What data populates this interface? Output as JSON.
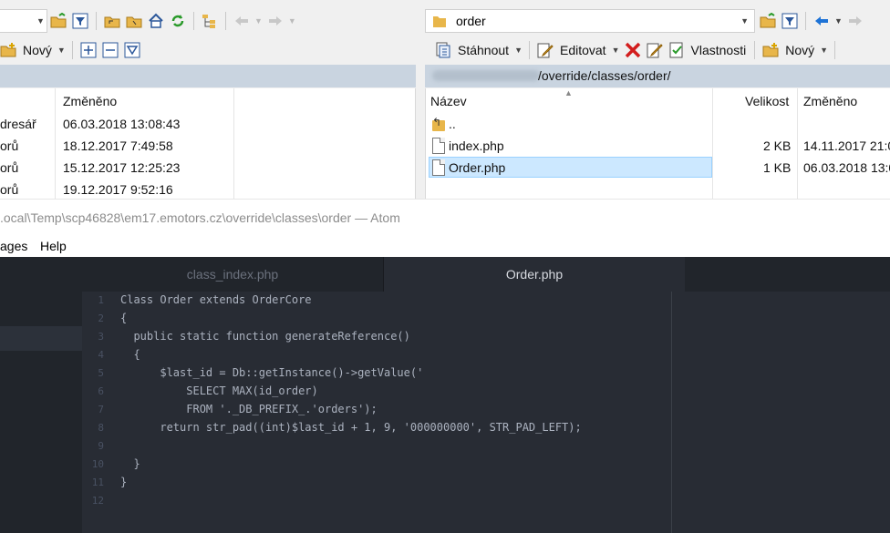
{
  "left_toolbar": {
    "new_label": "Nový"
  },
  "right_toolbar": {
    "path_combo": "order",
    "download_label": "Stáhnout",
    "edit_label": "Editovat",
    "properties_label": "Vlastnosti",
    "new_label": "Nový"
  },
  "left_panel": {
    "changed_header": "Změněno",
    "rows": [
      {
        "name": "dresář",
        "changed": "06.03.2018  13:08:43"
      },
      {
        "name": "orů",
        "changed": "18.12.2017  7:49:58"
      },
      {
        "name": "orů",
        "changed": "15.12.2017  12:25:23"
      },
      {
        "name": "orů",
        "changed": "19.12.2017  9:52:16"
      }
    ]
  },
  "right_panel": {
    "path": "/override/classes/order/",
    "headers": {
      "name": "Název",
      "size": "Velikost",
      "changed": "Změněno"
    },
    "rows": [
      {
        "name": "..",
        "size": "",
        "changed": "",
        "icon": "parent-folder-icon"
      },
      {
        "name": "index.php",
        "size": "2 KB",
        "changed": "14.11.2017  21:0",
        "icon": "file-icon"
      },
      {
        "name": "Order.php",
        "size": "1 KB",
        "changed": "06.03.2018  13:0",
        "icon": "file-icon",
        "selected": true
      }
    ]
  },
  "atom": {
    "title": ".ocal\\Temp\\scp46828\\em17.emotors.cz\\override\\classes\\order — Atom",
    "menu": [
      "ages",
      "Help"
    ],
    "tabs": [
      {
        "label": "class_index.php",
        "active": false
      },
      {
        "label": "Order.php",
        "active": true
      }
    ],
    "code_lines": [
      {
        "n": "1",
        "text": "Class Order extends OrderCore"
      },
      {
        "n": "2",
        "text": "{"
      },
      {
        "n": "3",
        "text": "  public static function generateReference()"
      },
      {
        "n": "4",
        "text": "  {"
      },
      {
        "n": "5",
        "text": "      $last_id = Db::getInstance()->getValue('"
      },
      {
        "n": "6",
        "text": "          SELECT MAX(id_order)"
      },
      {
        "n": "7",
        "text": "          FROM '._DB_PREFIX_.'orders');"
      },
      {
        "n": "8",
        "text": "      return str_pad((int)$last_id + 1, 9, '000000000', STR_PAD_LEFT);"
      },
      {
        "n": "9",
        "text": ""
      },
      {
        "n": "10",
        "text": "  }"
      },
      {
        "n": "11",
        "text": "}"
      },
      {
        "n": "12",
        "text": ""
      }
    ]
  },
  "colors": {
    "atom_bg": "#282c34",
    "atom_sidebar": "#21252b",
    "selection": "#cce8ff",
    "path_bar": "#c9d4e0"
  }
}
